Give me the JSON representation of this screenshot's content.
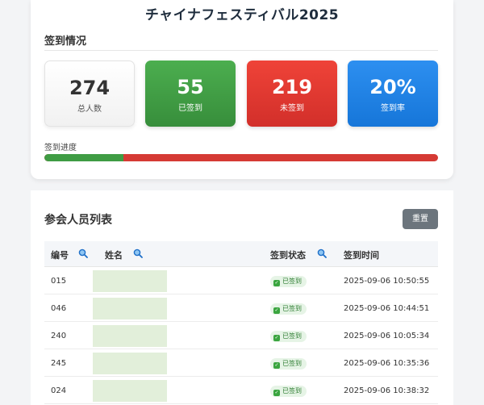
{
  "page": {
    "title": "チャイナフェスティバル2025"
  },
  "summary": {
    "section_label": "签到情况",
    "cards": {
      "total": {
        "value": "274",
        "label": "总人数"
      },
      "checked_in": {
        "value": "55",
        "label": "已签到"
      },
      "not_checked_in": {
        "value": "219",
        "label": "未签到"
      },
      "rate": {
        "value": "20%",
        "label": "签到率"
      }
    },
    "progress": {
      "label": "签到进度",
      "percent": 20
    }
  },
  "list": {
    "title": "参会人员列表",
    "reset_label": "重置",
    "columns": {
      "id": "编号",
      "name": "姓名",
      "status": "签到状态",
      "time": "签到时间"
    },
    "rows": [
      {
        "id": "015",
        "status": "已签到",
        "time": "2025-09-06 10:50:55"
      },
      {
        "id": "046",
        "status": "已签到",
        "time": "2025-09-06 10:44:51"
      },
      {
        "id": "240",
        "status": "已签到",
        "time": "2025-09-06 10:05:34"
      },
      {
        "id": "245",
        "status": "已签到",
        "time": "2025-09-06 10:35:36"
      },
      {
        "id": "024",
        "status": "已签到",
        "time": "2025-09-06 10:38:32"
      }
    ]
  },
  "colors": {
    "checked_green": "#3f9c44",
    "unchecked_red": "#d53a34",
    "rate_blue": "#1e88e5",
    "name_mask": "#e2efda",
    "reset_gray": "#6c757d"
  }
}
